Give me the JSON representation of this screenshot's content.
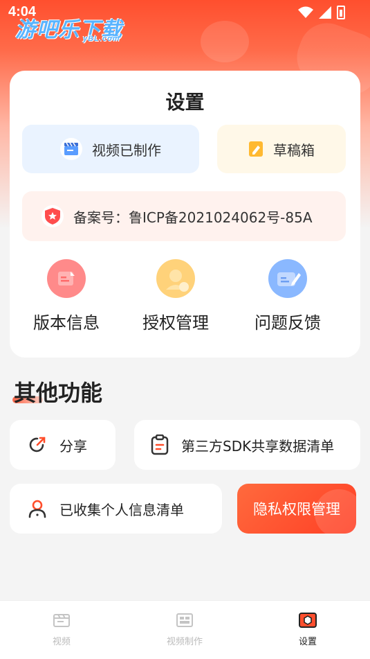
{
  "status_bar": {
    "time": "4:04"
  },
  "watermark": {
    "text": "游吧乐下载",
    "sub": "yBL.com"
  },
  "settings_card": {
    "title": "设置",
    "video_made_label": "视频已制作",
    "drafts_label": "草稿箱",
    "record_label": "备案号：鲁ICP备2021024062号-85A",
    "quick_items": [
      {
        "label": "版本信息",
        "icon": "version-info-icon",
        "color": "#ff8a8a"
      },
      {
        "label": "授权管理",
        "icon": "authorization-icon",
        "color": "#ffd27a"
      },
      {
        "label": "问题反馈",
        "icon": "feedback-icon",
        "color": "#8ab8ff"
      }
    ]
  },
  "other_section": {
    "title": "其他功能",
    "share_label": "分享",
    "sdk_list_label": "第三方SDK共享数据清单",
    "personal_info_label": "已收集个人信息清单",
    "privacy_label": "隐私权限管理"
  },
  "tabbar": {
    "tabs": [
      {
        "label": "视频",
        "icon": "video-tab-icon",
        "active": false
      },
      {
        "label": "视频制作",
        "icon": "video-make-tab-icon",
        "active": false
      },
      {
        "label": "设置",
        "icon": "settings-tab-icon",
        "active": true
      }
    ]
  },
  "colors": {
    "accent": "#ff4f2e",
    "blue_pill": "#eaf3ff",
    "yellow_pill": "#fff8e8",
    "pink_pill": "#fff2ee"
  }
}
